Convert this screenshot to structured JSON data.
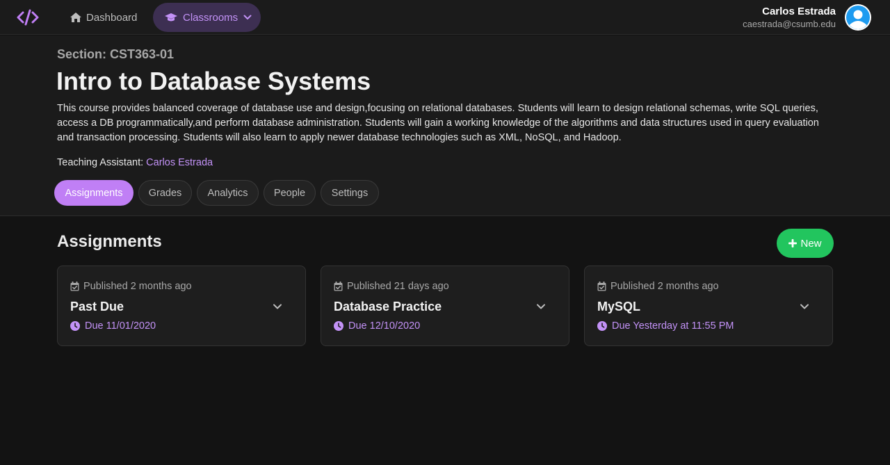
{
  "nav": {
    "logo_icon": "code-icon",
    "dashboard_label": "Dashboard",
    "classrooms_label": "Classrooms",
    "user_name": "Carlos Estrada",
    "user_email": "caestrada@csumb.edu"
  },
  "course": {
    "section": "Section: CST363-01",
    "title": "Intro to Database Systems",
    "description": "This course provides balanced coverage of database use and design,focusing on relational databases. Students will learn to design relational schemas, write SQL queries, access a DB programmatically,and perform database administration. Students will gain a working knowledge of the algorithms and data structures used in query evaluation and transaction processing. Students will also learn to apply newer database technologies such as XML, NoSQL, and Hadoop.",
    "ta_label": "Teaching Assistant:",
    "ta_name": "Carlos Estrada"
  },
  "tabs": [
    "Assignments",
    "Grades",
    "Analytics",
    "People",
    "Settings"
  ],
  "active_tab": "Assignments",
  "main": {
    "title": "Assignments",
    "new_label": "New"
  },
  "assignments": [
    {
      "published": "Published 2 months ago",
      "title": "Past Due",
      "due": "Due 11/01/2020"
    },
    {
      "published": "Published 21 days ago",
      "title": "Database Practice",
      "due": "Due 12/10/2020"
    },
    {
      "published": "Published 2 months ago",
      "title": "MySQL",
      "due": "Due Yesterday at 11:55 PM"
    }
  ],
  "colors": {
    "accent": "#c07ff5",
    "accent_text": "#c392f7",
    "success": "#22c55e",
    "background": "#131313",
    "surface": "#1b1b1b"
  }
}
